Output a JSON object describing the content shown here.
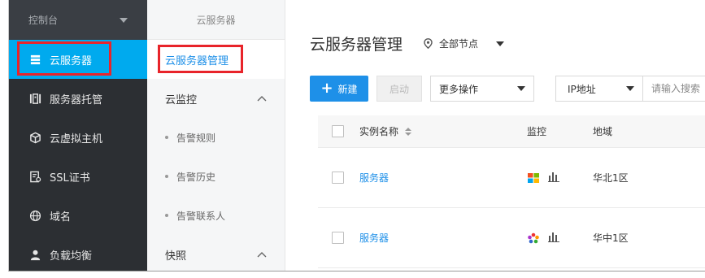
{
  "sidebar": {
    "console_label": "控制台",
    "items": [
      {
        "label": "云服务器",
        "icon": "server-list-icon",
        "active": true
      },
      {
        "label": "服务器托管",
        "icon": "server-rack-icon"
      },
      {
        "label": "云虚拟主机",
        "icon": "cube-icon"
      },
      {
        "label": "SSL证书",
        "icon": "certificate-icon"
      },
      {
        "label": "域名",
        "icon": "globe-icon"
      },
      {
        "label": "负载均衡",
        "icon": "user-balance-icon"
      }
    ]
  },
  "subnav": {
    "title": "云服务器",
    "current": "云服务器管理",
    "monitor_group": "云监控",
    "monitor_items": [
      "告警规则",
      "告警历史",
      "告警联系人"
    ],
    "snapshot_group": "快照"
  },
  "main": {
    "title": "云服务器管理",
    "region_selector": "全部节点",
    "toolbar": {
      "new_label": "新建",
      "start_label": "启动",
      "more_label": "更多操作",
      "ip_filter_label": "IP地址",
      "search_placeholder": "请输入搜索"
    },
    "table": {
      "headers": {
        "name": "实例名称",
        "monitor": "监控",
        "region": "地域"
      },
      "rows": [
        {
          "name": "服务器",
          "os": "windows-icon",
          "region": "华北1区"
        },
        {
          "name": "服务器",
          "os": "linux-flower-icon",
          "region": "华中1区"
        }
      ]
    }
  },
  "colors": {
    "sidebar_bg": "#2c2f33",
    "active_blue": "#00aaee",
    "link_blue": "#1e90e8",
    "highlight_red": "#e8242a"
  }
}
